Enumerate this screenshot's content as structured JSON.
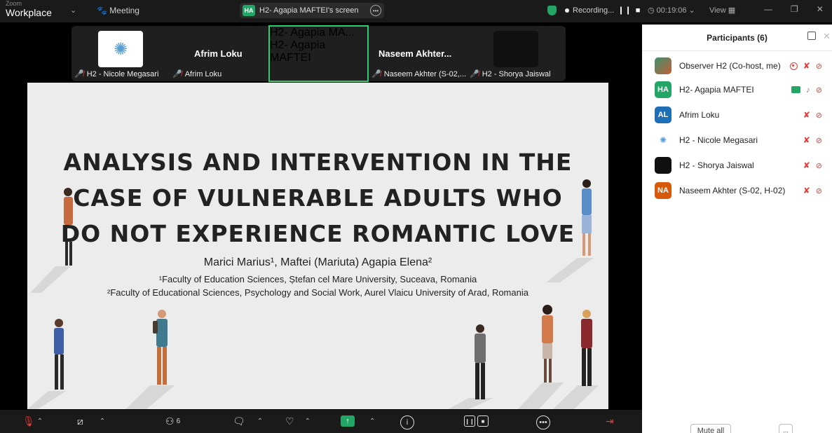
{
  "titlebar": {
    "app_sub": "Zoom",
    "app_name": "Workplace",
    "meeting_label": "Meeting",
    "screen_pill_avatar": "HA",
    "screen_pill_label": "H2- Agapia MAFTEI's screen",
    "recording_label": "Recording...",
    "timer": "00:19:06",
    "view_label": "View"
  },
  "strip": {
    "tiles": [
      {
        "label": "H2 - Nicole Megasari"
      },
      {
        "big_name": "Afrim Loku",
        "label": "Afrim Loku"
      },
      {
        "big_name": "H2- Agapia MA...",
        "label": "H2- Agapia MAFTEI"
      },
      {
        "big_name": "Naseem Akhter...",
        "label": "Naseem Akhter (S-02,..."
      },
      {
        "label": "H2 - Shorya Jaiswal"
      }
    ]
  },
  "slide": {
    "title_lines": [
      "ANALYSIS AND INTERVENTION IN THE",
      "CASE OF VULNERABLE ADULTS WHO",
      "DO NOT EXPERIENCE ROMANTIC LOVE"
    ],
    "authors": "Marici Marius¹, Maftei (Mariuta) Agapia Elena²",
    "affiliation_1": "¹Faculty of Education Sciences, Ștefan cel Mare University, Suceava, Romania",
    "affiliation_2": "²Faculty of Educational Sciences, Psychology and Social Work, Aurel Vlaicu University of Arad, Romania"
  },
  "participants": {
    "title": "Participants (6)",
    "list": [
      {
        "name": "Observer H2 (Co-host, me)",
        "avatar": "",
        "avatar_color": "#3f8f6f"
      },
      {
        "name": "H2- Agapia MAFTEI",
        "avatar": "HA",
        "avatar_color": "#23a566"
      },
      {
        "name": "Afrim Loku",
        "avatar": "AL",
        "avatar_color": "#1e6fb5"
      },
      {
        "name": "H2 - Nicole Megasari",
        "avatar": "",
        "avatar_color": "#ffffff"
      },
      {
        "name": "H2 - Shorya Jaiswal",
        "avatar": "",
        "avatar_color": "#111111"
      },
      {
        "name": "Naseem Akhter (S-02, H-02)",
        "avatar": "NA",
        "avatar_color": "#d9590b"
      }
    ],
    "mute_all_label": "Mute all",
    "more_label": "..."
  },
  "toolbar": {
    "participants_count": "6"
  },
  "colors": {
    "zoom_green": "#23a566",
    "mute_red": "#e53935",
    "toolbar_bg": "#1a1a1a"
  }
}
